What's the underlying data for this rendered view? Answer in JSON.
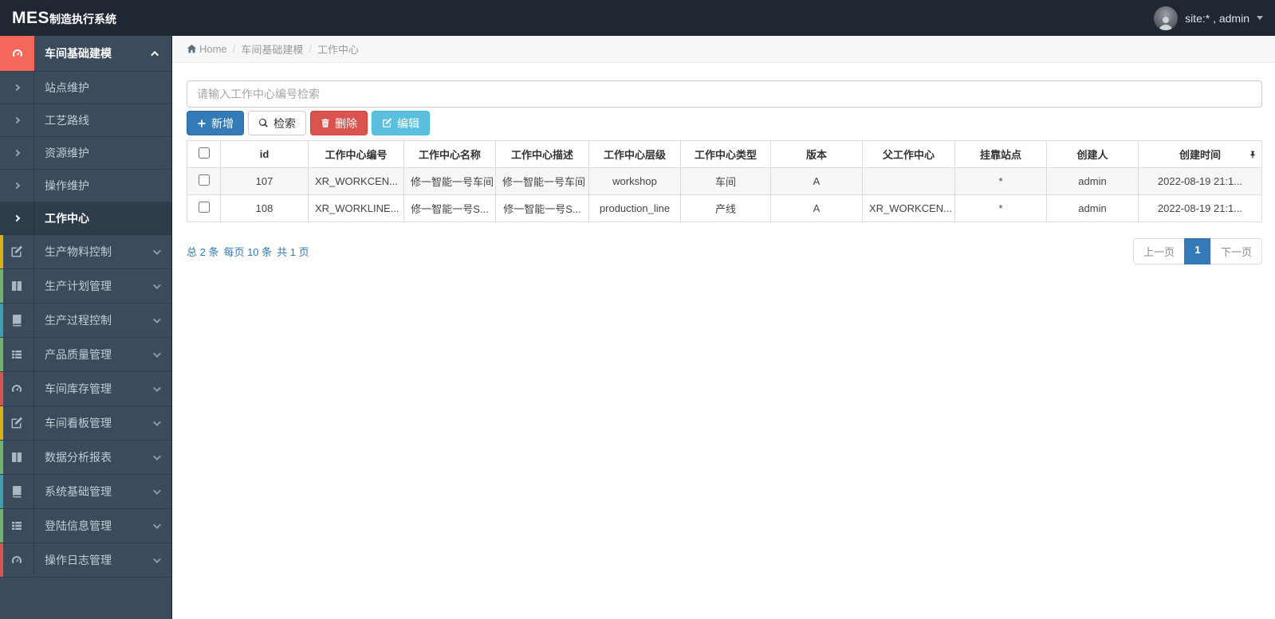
{
  "topbar": {
    "brand_bold": "MES",
    "brand_rest": "制造执行系统",
    "user_label": "site:* , admin"
  },
  "breadcrumb": {
    "items": [
      "Home",
      "车间基础建模",
      "工作中心"
    ]
  },
  "sidebar": {
    "parent_label": "车间基础建模",
    "sub_items": [
      "站点维护",
      "工艺路线",
      "资源维护",
      "操作维护",
      "工作中心"
    ],
    "active_sub": "工作中心",
    "items": [
      "生产物料控制",
      "生产计划管理",
      "生产过程控制",
      "产品质量管理",
      "车间库存管理",
      "车间看板管理",
      "数据分析报表",
      "系统基础管理",
      "登陆信息管理",
      "操作日志管理"
    ]
  },
  "search": {
    "placeholder": "请输入工作中心编号检索",
    "value": ""
  },
  "toolbar": {
    "add_label": "新增",
    "search_label": "检索",
    "delete_label": "删除",
    "edit_label": "编辑"
  },
  "table": {
    "columns": [
      "id",
      "工作中心编号",
      "工作中心名称",
      "工作中心描述",
      "工作中心层级",
      "工作中心类型",
      "版本",
      "父工作中心",
      "挂靠站点",
      "创建人",
      "创建时间"
    ],
    "rows": [
      [
        "107",
        "XR_WORKCEN...",
        "修一智能一号车间",
        "修一智能一号车间",
        "workshop",
        "车间",
        "A",
        "",
        "*",
        "admin",
        "2022-08-19 21:1..."
      ],
      [
        "108",
        "XR_WORKLINE...",
        "修一智能一号S...",
        "修一智能一号S...",
        "production_line",
        "产线",
        "A",
        "XR_WORKCEN...",
        "*",
        "admin",
        "2022-08-19 21:1..."
      ]
    ]
  },
  "pagination": {
    "total": "总 2 条",
    "per_page": "每页 10 条",
    "pages": "共 1 页",
    "prev_label": "上一页",
    "current_page": "1",
    "next_label": "下一页"
  },
  "colors": {
    "topbar": "#1f2832",
    "sidebar": "#3a4b5b",
    "active_parent_icon": "#f4685c",
    "primary": "#337ab7",
    "danger": "#d9534f",
    "info": "#5bc0de",
    "strip_yellow": "#d8b117",
    "strip_green": "#6fb36f",
    "strip_teal": "#3f9db1",
    "strip_red": "#d9534f"
  },
  "icons": {
    "brand": "none",
    "breadcrumb_home": "home-icon",
    "sidebar_parent": "gauge-icon",
    "sidebar_items": [
      "edit-icon",
      "columns-icon",
      "book-icon",
      "list-icon",
      "gauge-icon",
      "edit-icon",
      "columns-icon",
      "book-icon",
      "list-icon",
      "gauge-icon"
    ],
    "toolbar": [
      "plus-icon",
      "search-icon",
      "trash-icon",
      "edit-icon"
    ],
    "table_header_pin": "pin-icon",
    "user_caret": "caret-down-icon"
  }
}
